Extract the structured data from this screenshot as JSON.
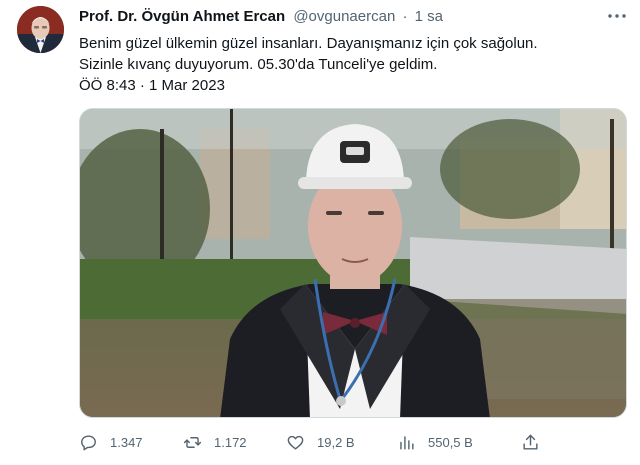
{
  "tweet": {
    "display_name": "Prof. Dr. Övgün Ahmet Ercan",
    "handle": "@ovgunaercan",
    "separator": "·",
    "age": "1 sa",
    "text_line1": "Benim güzel ülkemin güzel insanları. Dayanışmanız için çok sağolun.",
    "text_line2": "Sizinle kıvanç duyuyorum. 05.30'da Tunceli'ye geldim.",
    "text_line3": "ÖÖ 8:43 · 1 Mar 2023"
  },
  "actions": {
    "replies": "1.347",
    "retweets": "1.172",
    "likes": "19,2 B",
    "views": "550,5 B"
  },
  "icons": {
    "more": "more-icon",
    "reply": "reply-icon",
    "retweet": "retweet-icon",
    "like": "heart-icon",
    "views": "views-icon",
    "share": "share-icon"
  },
  "colors": {
    "text": "#0f1419",
    "secondary": "#536471",
    "border": "#cfd9de"
  }
}
